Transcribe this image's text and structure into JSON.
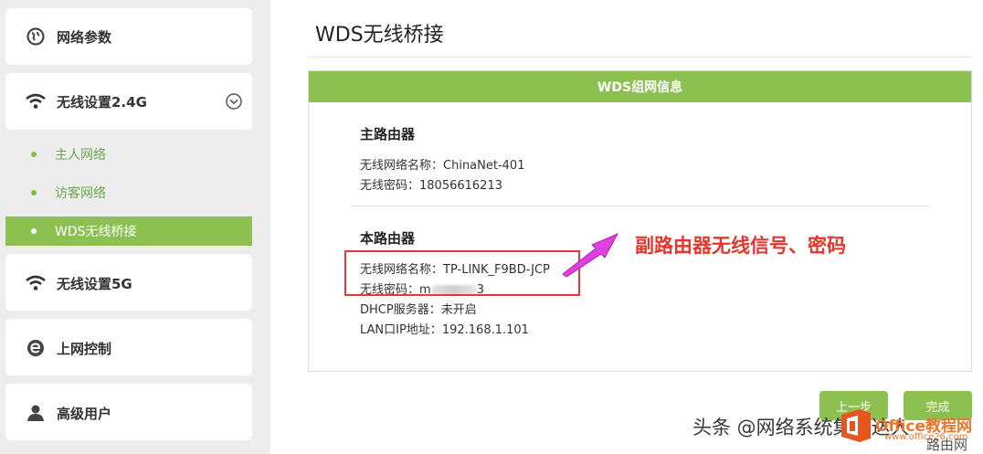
{
  "sidebar": {
    "network_params": {
      "label": "网络参数",
      "icon": "globe-icon"
    },
    "wireless_24": {
      "label": "无线设置2.4G",
      "icon": "wifi-icon",
      "expanded": true,
      "items": [
        {
          "label": "主人网络",
          "active": false
        },
        {
          "label": "访客网络",
          "active": false
        },
        {
          "label": "WDS无线桥接",
          "active": true
        }
      ]
    },
    "wireless_5g": {
      "label": "无线设置5G",
      "icon": "wifi-icon"
    },
    "internet_control": {
      "label": "上网控制",
      "icon": "e-icon"
    },
    "advanced_user": {
      "label": "高级用户",
      "icon": "user-icon"
    }
  },
  "main": {
    "title": "WDS无线桥接",
    "panel": {
      "header": "WDS组网信息",
      "main_router": {
        "title": "主路由器",
        "ssid_label": "无线网络名称：",
        "ssid": "ChinaNet-401",
        "password_label": "无线密码：",
        "password": "18056616213"
      },
      "this_router": {
        "title": "本路由器",
        "ssid_label": "无线网络名称：",
        "ssid": "TP-LINK_F9BD-JCP",
        "password_label": "无线密码：",
        "password_visible_start": "m",
        "password_visible_end": "3",
        "dhcp_label": "DHCP服务器：",
        "dhcp": "未开启",
        "lan_ip_label": "LAN口IP地址：",
        "lan_ip": "192.168.1.101"
      }
    },
    "annotation": "副路由器无线信号、密码",
    "buttons": {
      "prev": "上一步",
      "done": "完成"
    }
  },
  "watermarks": {
    "toutiao": "头条 @网络系统集成达人",
    "office_site": "Office教程网",
    "office_url": "www.office26.com",
    "lu": "路由网"
  },
  "colors": {
    "accent_green": "#8cc152",
    "annotation_red": "#e8352c",
    "arrow_magenta": "#e040e0"
  }
}
